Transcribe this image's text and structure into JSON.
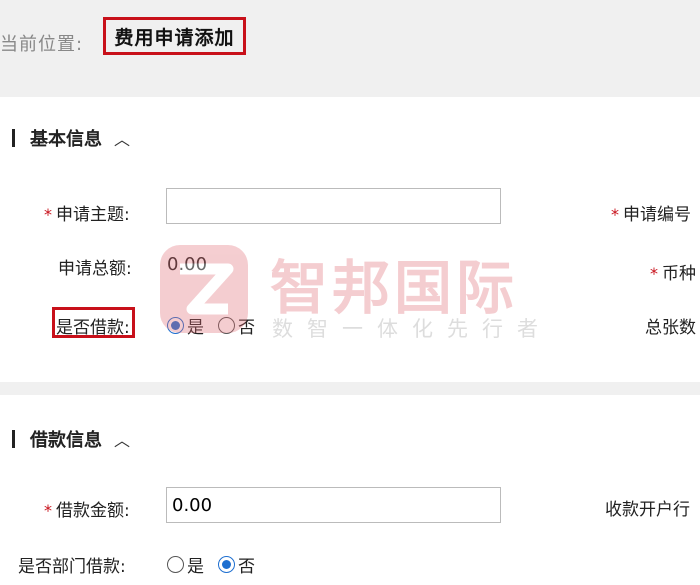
{
  "breadcrumb": {
    "label": "当前位置:",
    "current": "费用申请添加"
  },
  "basic_section": {
    "title": "基本信息",
    "chevron": "︿",
    "subject_label": "申请主题:",
    "subject_value": "",
    "number_label": "申请编号",
    "total_label": "申请总额:",
    "total_value": "0.00",
    "currency_label": "币种",
    "is_loan_label": "是否借款:",
    "is_loan_options": [
      "是",
      "否"
    ],
    "is_loan_selected": "是",
    "total_sheets_label": "总张数"
  },
  "loan_section": {
    "title": "借款信息",
    "chevron": "︿",
    "amount_label": "借款金额:",
    "amount_value": "0.00",
    "bank_label": "收款开户行",
    "dept_loan_label": "是否部门借款:",
    "dept_loan_options": [
      "是",
      "否"
    ],
    "dept_loan_selected": "否"
  },
  "watermark": {
    "brand": "智邦国际",
    "slogan": "数智一体化先行者"
  },
  "colors": {
    "highlight": "#c8101a",
    "radio_accent": "#1e6fd0",
    "required": "#c8101a"
  }
}
